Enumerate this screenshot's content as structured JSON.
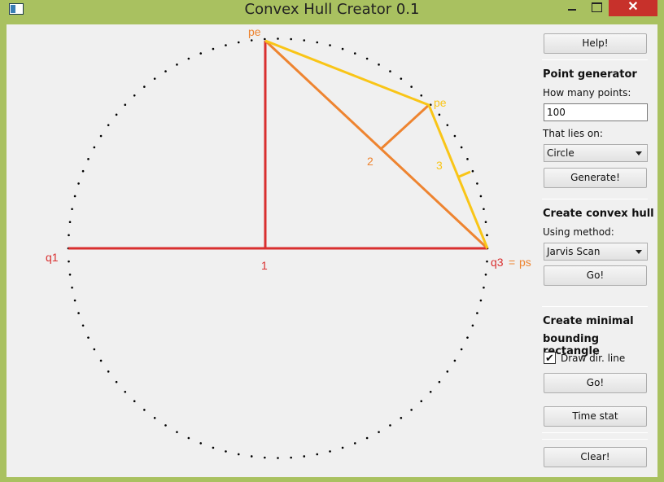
{
  "window": {
    "title": "Convex Hull Creator 0.1",
    "close_glyph": "✕"
  },
  "canvas": {
    "point_count": 100,
    "labels": {
      "pe_top": "pe",
      "pe_right": "pe",
      "q1": "q1",
      "q3": "q3",
      "eq": "=",
      "ps": "ps",
      "one": "1",
      "two": "2",
      "three": "3"
    },
    "colors": {
      "red": "#d92f2f",
      "orange": "#ee8430",
      "yellow": "#f9c517",
      "points": "#000000"
    }
  },
  "panel": {
    "help_button": "Help!",
    "point_generator": {
      "title": "Point generator",
      "count_label": "How many points:",
      "count_value": "100",
      "shape_label": "That lies on:",
      "shape_value": "Circle",
      "generate_button": "Generate!"
    },
    "convex_hull": {
      "title": "Create convex hull",
      "method_label": "Using method:",
      "method_value": "Jarvis Scan",
      "go_button": "Go!"
    },
    "bounding_rect": {
      "title_line1": "Create minimal",
      "title_line2": "bounding rectangle",
      "checkbox_label": "Draw dir. line",
      "checkbox_checked": true,
      "check_glyph": "✔",
      "go_button": "Go!"
    },
    "time_stat_button": "Time stat",
    "clear_button": "Clear!"
  }
}
